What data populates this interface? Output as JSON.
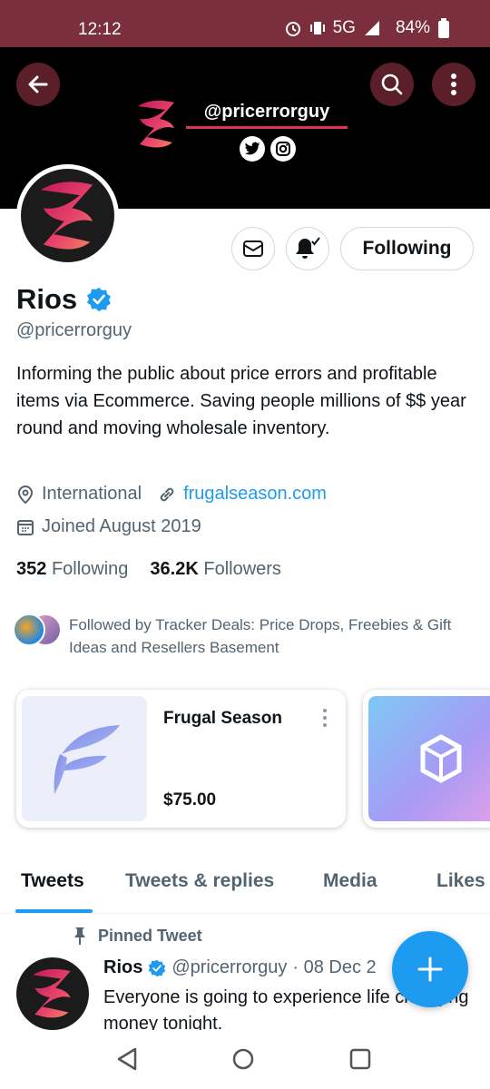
{
  "status_bar": {
    "time": "12:12",
    "network": "5G",
    "battery": "84%"
  },
  "banner": {
    "handle": "@pricerrorguy",
    "accent": "#e0344d"
  },
  "actions": {
    "following_label": "Following"
  },
  "profile": {
    "name": "Rios",
    "handle": "@pricerrorguy",
    "bio": "Informing the public about price errors and profitable items via Ecommerce. Saving people millions of $$ year round and moving wholesale inventory.",
    "location": "International",
    "website": "frugalseason.com",
    "joined": "Joined August 2019",
    "following_count": "352",
    "following_label": "Following",
    "followers_count": "36.2K",
    "followers_label": "Followers",
    "followed_by": "Followed by Tracker Deals: Price Drops, Freebies & Gift Ideas and Resellers Basement"
  },
  "shop": {
    "items": [
      {
        "title": "Frugal Season",
        "price": "$75.00"
      }
    ]
  },
  "tabs": [
    {
      "label": "Tweets",
      "active": true
    },
    {
      "label": "Tweets & replies"
    },
    {
      "label": "Media"
    },
    {
      "label": "Likes"
    }
  ],
  "tweet": {
    "pinned_label": "Pinned Tweet",
    "name": "Rios",
    "handle": "@pricerrorguy",
    "date": "· 08 Dec 2",
    "text": "Everyone is going to experience life changing money tonight."
  },
  "colors": {
    "accent": "#1d9bf0",
    "status_bar": "#7b2e3b",
    "banner": "#000000"
  },
  "icons": [
    "back-arrow",
    "search",
    "more-vertical",
    "twitter",
    "instagram",
    "mail",
    "bell-checked",
    "verified-badge",
    "location-pin",
    "link",
    "calendar",
    "pin",
    "plus"
  ]
}
